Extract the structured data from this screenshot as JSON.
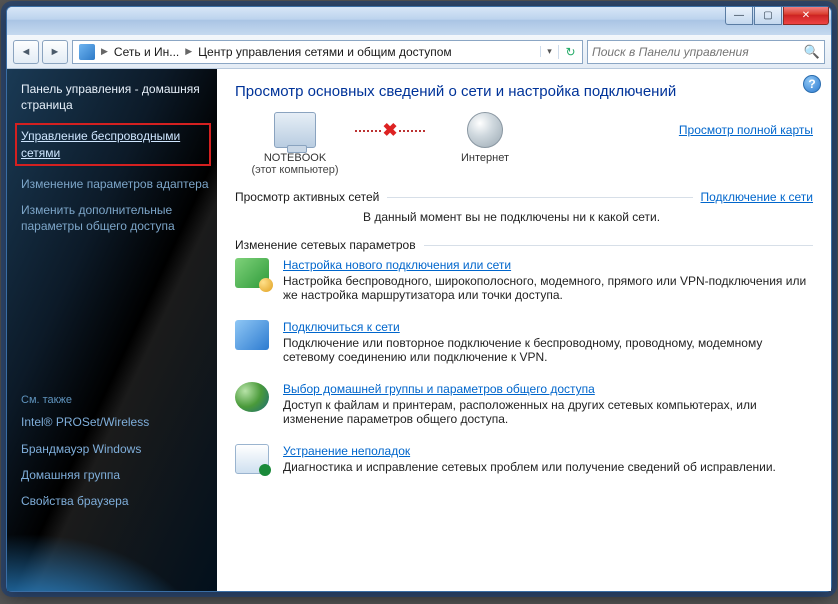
{
  "titlebar": {
    "min": "—",
    "max": "▢",
    "close": "✕"
  },
  "toolbar": {
    "back": "◄",
    "forward": "►",
    "crumb1": "Сеть и Ин...",
    "crumb2": "Центр управления сетями и общим доступом",
    "refresh": "↻",
    "search_placeholder": "Поиск в Панели управления",
    "search_icon": "🔍"
  },
  "sidebar": {
    "home": "Панель управления - домашняя страница",
    "wireless": "Управление беспроводными сетями",
    "adapter": "Изменение параметров адаптера",
    "advanced": "Изменить дополнительные параметры общего доступа",
    "see_also": "См. также",
    "links": [
      "Intel® PROSet/Wireless",
      "Брандмауэр Windows",
      "Домашняя группа",
      "Свойства браузера"
    ]
  },
  "main": {
    "help": "?",
    "heading": "Просмотр основных сведений о сети и настройка подключений",
    "node_pc": "NOTEBOOK",
    "node_pc_sub": "(этот компьютер)",
    "node_net": "Интернет",
    "fullmap": "Просмотр полной карты",
    "active_h": "Просмотр активных сетей",
    "active_link": "Подключение к сети",
    "active_note": "В данный момент вы не подключены ни к какой сети.",
    "change_h": "Изменение сетевых параметров",
    "opts": [
      {
        "title": "Настройка нового подключения или сети",
        "desc": "Настройка беспроводного, широкополосного, модемного, прямого или VPN-подключения или же настройка маршрутизатора или точки доступа."
      },
      {
        "title": "Подключиться к сети",
        "desc": "Подключение или повторное подключение к беспроводному, проводному, модемному сетевому соединению или подключение к VPN."
      },
      {
        "title": "Выбор домашней группы и параметров общего доступа",
        "desc": "Доступ к файлам и принтерам, расположенных на других сетевых компьютерах, или изменение параметров общего доступа."
      },
      {
        "title": "Устранение неполадок",
        "desc": "Диагностика и исправление сетевых проблем или получение сведений об исправлении."
      }
    ]
  }
}
